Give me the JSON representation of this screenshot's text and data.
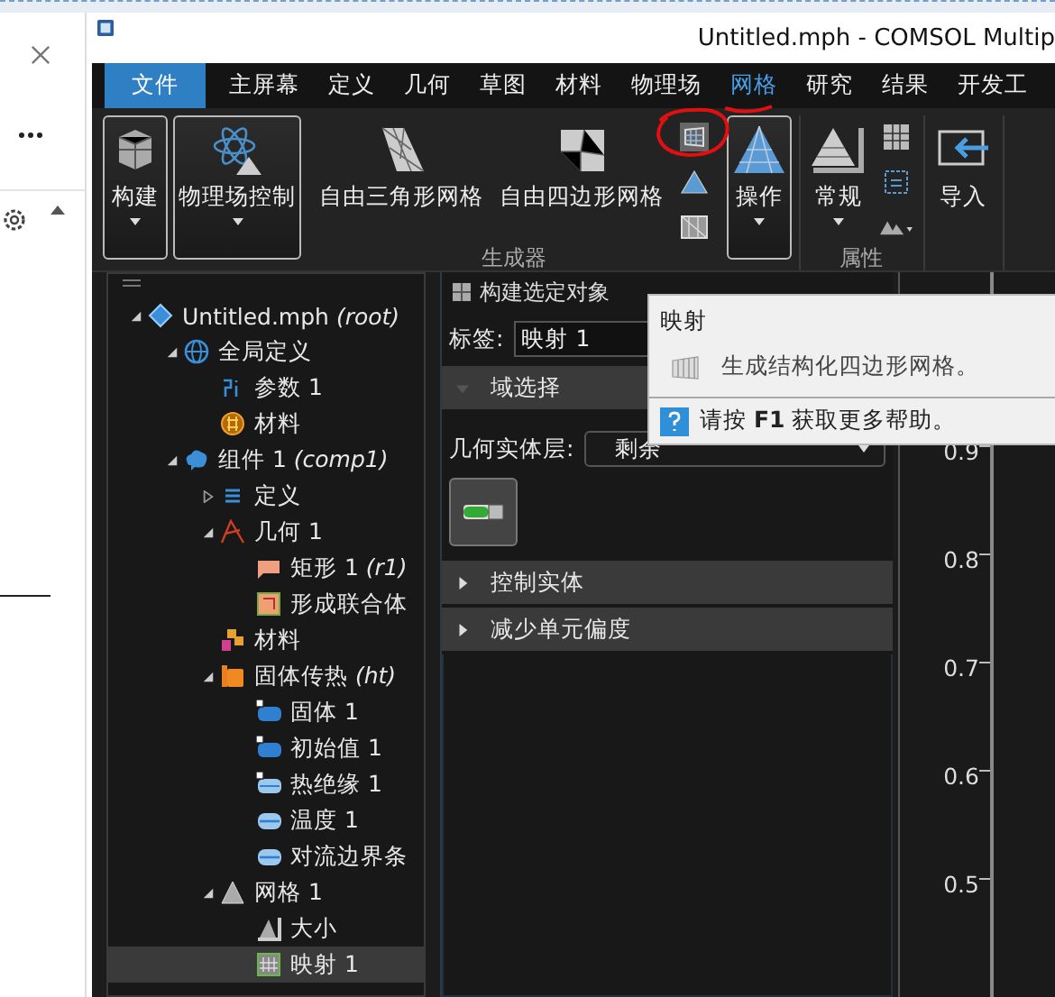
{
  "window": {
    "title": "Untitled.mph - COMSOL Multip"
  },
  "menu": [
    {
      "label": "文件",
      "kind": "file",
      "selected": false
    },
    {
      "label": "主屏幕",
      "kind": "tab",
      "selected": false
    },
    {
      "label": "定义",
      "kind": "tab",
      "selected": false
    },
    {
      "label": "几何",
      "kind": "tab",
      "selected": false
    },
    {
      "label": "草图",
      "kind": "tab",
      "selected": false
    },
    {
      "label": "材料",
      "kind": "tab",
      "selected": false
    },
    {
      "label": "物理场",
      "kind": "tab",
      "selected": false
    },
    {
      "label": "网格",
      "kind": "tab",
      "selected": true
    },
    {
      "label": "研究",
      "kind": "tab",
      "selected": false
    },
    {
      "label": "结果",
      "kind": "tab",
      "selected": false
    },
    {
      "label": "开发工",
      "kind": "tab",
      "selected": false
    }
  ],
  "ribbon": [
    {
      "buttons": [
        {
          "label": "构建",
          "kind": "build",
          "framed": true,
          "dropdown": true
        },
        {
          "label": "物理场控制",
          "kind": "physics",
          "framed": true,
          "dropdown": true
        }
      ]
    },
    {
      "label": "生成器",
      "buttons": [
        {
          "label": "自由三角形网格",
          "kind": "free-tri",
          "framed": false,
          "dropdown": false
        },
        {
          "label": "自由四边形网格",
          "kind": "free-quad",
          "framed": false,
          "dropdown": false
        },
        {
          "kind": "small-mesh"
        }
      ]
    },
    {
      "buttons": [
        {
          "label": "操作",
          "kind": "operations",
          "framed": true,
          "dropdown": true
        }
      ]
    },
    {
      "label": "属性",
      "buttons": [
        {
          "label": "常规",
          "kind": "general",
          "framed": false,
          "dropdown": true
        },
        {
          "kind": "small-props"
        }
      ]
    },
    {
      "buttons": [
        {
          "label": "导入",
          "kind": "import",
          "framed": false,
          "dropdown": false
        }
      ]
    }
  ],
  "tree": [
    {
      "label": "Untitled.mph *(root)*",
      "kind": "file",
      "expanded": true,
      "selected": false,
      "children": [
        {
          "label": "全局定义",
          "kind": "globe",
          "expanded": true,
          "selected": false,
          "children": [
            {
              "label": "参数 1",
              "kind": "param",
              "selected": false
            },
            {
              "label": "材料",
              "kind": "material",
              "selected": false
            }
          ]
        },
        {
          "label": "组件 1 *(comp1)*",
          "kind": "component",
          "expanded": true,
          "selected": false,
          "children": [
            {
              "label": "定义",
              "kind": "list",
              "expanded": false,
              "selected": false
            },
            {
              "label": "几何 1",
              "kind": "geometry",
              "expanded": true,
              "selected": false,
              "children": [
                {
                  "label": "矩形 1 *(r1)*",
                  "kind": "rect",
                  "selected": false
                },
                {
                  "label": "形成联合体",
                  "kind": "union",
                  "selected": false
                }
              ]
            },
            {
              "label": "材料",
              "kind": "materials",
              "selected": false
            },
            {
              "label": "固体传热 *(ht)*",
              "kind": "physics",
              "expanded": true,
              "selected": false,
              "children": [
                {
                  "label": "固体 1",
                  "kind": "domain",
                  "selected": false
                },
                {
                  "label": "初始值 1",
                  "kind": "domain",
                  "selected": false
                },
                {
                  "label": "热绝缘 1",
                  "kind": "boundary",
                  "selected": false
                },
                {
                  "label": "温度 1",
                  "kind": "boundary2",
                  "selected": false
                },
                {
                  "label": "对流边界条",
                  "kind": "boundary2",
                  "selected": false
                }
              ]
            },
            {
              "label": "网格 1",
              "kind": "mesh",
              "expanded": true,
              "selected": false,
              "children": [
                {
                  "label": "大小",
                  "kind": "size",
                  "selected": false
                },
                {
                  "label": "映射 1",
                  "kind": "mapped",
                  "selected": true
                }
              ]
            }
          ]
        }
      ]
    }
  ],
  "settings": {
    "toolbar": "构建选定对象",
    "label_field": {
      "label": "标签:",
      "value": "映射 1"
    },
    "sections": [
      {
        "title": "域选择",
        "expanded": true,
        "level_label": "几何实体层:",
        "level_value": "剩余"
      },
      {
        "title": "控制实体",
        "expanded": false
      },
      {
        "title": "减少单元偏度",
        "expanded": false
      }
    ]
  },
  "tooltip": {
    "title": "映射",
    "description": "生成结构化四边形网格。",
    "help": "请按 **F1** 获取更多帮助。"
  },
  "plot": {
    "y_ticks": [
      "0.9",
      "0.8",
      "0.7",
      "0.6",
      "0.5"
    ]
  }
}
